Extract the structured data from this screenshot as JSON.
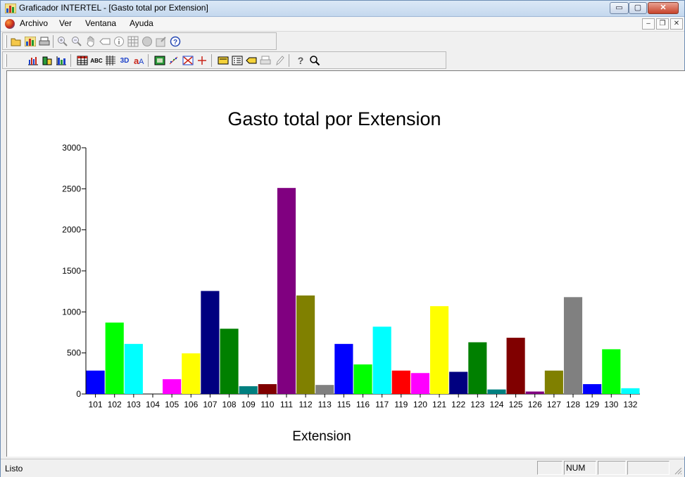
{
  "window": {
    "title": "Graficador INTERTEL - [Gasto total por Extension]",
    "min_glyph": "▭",
    "max_glyph": "▢",
    "close_glyph": "✕"
  },
  "menu": {
    "items": [
      "Archivo",
      "Ver",
      "Ventana",
      "Ayuda"
    ],
    "mdi_min": "–",
    "mdi_restore": "❐",
    "mdi_close": "✕"
  },
  "toolbar1": {
    "icons": [
      "open-icon",
      "gallery-icon",
      "print-icon",
      "zoom-in-icon",
      "zoom-out-icon",
      "pan-hand-icon",
      "label-icon",
      "info-icon",
      "grid-icon",
      "color-icon",
      "properties-icon",
      "help-circle-icon"
    ]
  },
  "toolbar2": {
    "icons": [
      "bar-chart-icon",
      "bar-3d-icon",
      "bar-horizontal-icon",
      "data-grid-icon",
      "text-abc-icon",
      "gridlines-icon",
      "view-3d-icon",
      "font-icon",
      "pattern-icon",
      "scatter-icon",
      "zoom-area-icon",
      "crosshair-icon",
      "title-icon",
      "legend-icon",
      "tag-icon",
      "printer-icon",
      "pen-icon",
      "question-icon",
      "magnifier-icon"
    ],
    "abc_text": "ABC",
    "threed_text": "3D",
    "help_text": "?"
  },
  "status": {
    "text": "Listo",
    "num": "NUM"
  },
  "chart_data": {
    "type": "bar",
    "title": "Gasto total por Extension",
    "xlabel": "Extension",
    "ylabel": "",
    "ylim": [
      0,
      3000
    ],
    "yticks": [
      0,
      500,
      1000,
      1500,
      2000,
      2500,
      3000
    ],
    "categories": [
      "101",
      "102",
      "103",
      "104",
      "105",
      "106",
      "107",
      "108",
      "109",
      "110",
      "111",
      "112",
      "113",
      "115",
      "116",
      "117",
      "119",
      "120",
      "121",
      "122",
      "123",
      "124",
      "125",
      "126",
      "127",
      "128",
      "129",
      "130",
      "132"
    ],
    "values": [
      285,
      870,
      610,
      0,
      180,
      495,
      1255,
      795,
      95,
      120,
      2510,
      1200,
      110,
      610,
      360,
      820,
      285,
      255,
      1070,
      270,
      630,
      55,
      685,
      30,
      285,
      1180,
      120,
      545,
      70
    ],
    "colors": [
      "#0000ff",
      "#00ff00",
      "#00ffff",
      "#ff0000",
      "#ff00ff",
      "#ffff00",
      "#000080",
      "#008000",
      "#008080",
      "#800000",
      "#800080",
      "#808000",
      "#808080",
      "#0000ff",
      "#00ff00",
      "#00ffff",
      "#ff0000",
      "#ff00ff",
      "#ffff00",
      "#000080",
      "#008000",
      "#008080",
      "#800000",
      "#800080",
      "#808000",
      "#808080",
      "#0000ff",
      "#00ff00",
      "#00ffff"
    ],
    "grid": false,
    "legend": "none"
  }
}
